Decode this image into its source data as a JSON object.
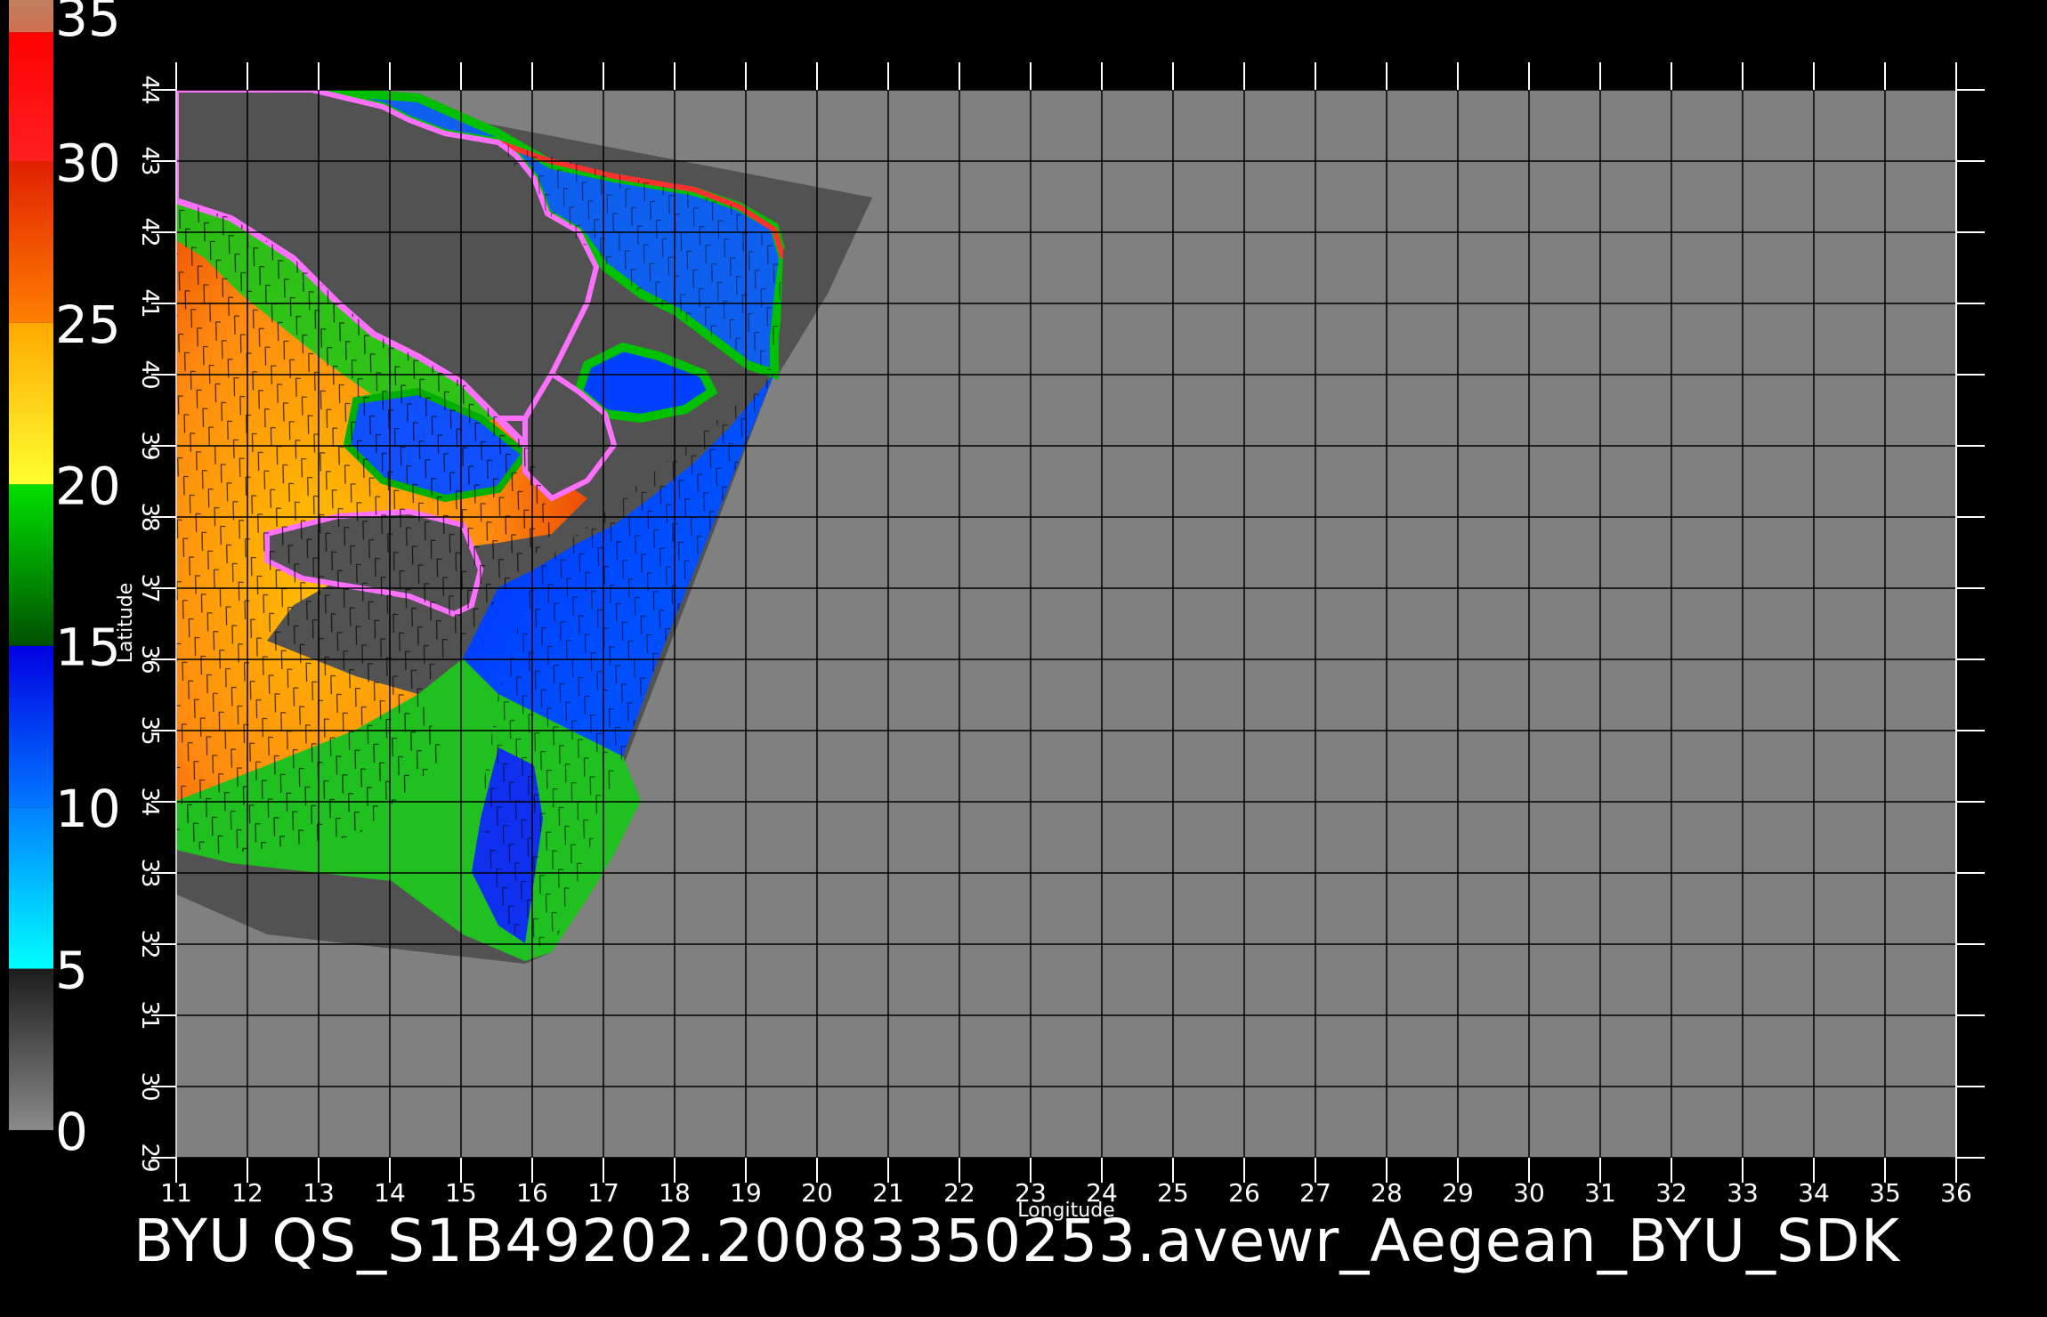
{
  "title": "BYU  QS_S1B49202.20083350253.avewr_Aegean_BYU_SDK",
  "axes": {
    "xlabel": "Longitude",
    "ylabel": "Latitude",
    "xlim": [
      11,
      36
    ],
    "ylim": [
      29,
      44
    ],
    "xticks": [
      "11",
      "12",
      "13",
      "14",
      "15",
      "16",
      "17",
      "18",
      "19",
      "20",
      "21",
      "22",
      "23",
      "24",
      "25",
      "26",
      "27",
      "28",
      "29",
      "30",
      "31",
      "32",
      "33",
      "34",
      "35",
      "36"
    ],
    "yticks": [
      "29",
      "30",
      "31",
      "32",
      "33",
      "34",
      "35",
      "36",
      "37",
      "38",
      "39",
      "40",
      "41",
      "42",
      "43",
      "44"
    ]
  },
  "colorbar": {
    "labels": [
      "0",
      "5",
      "10",
      "15",
      "20",
      "25",
      "30",
      "35"
    ],
    "range": [
      0,
      35
    ],
    "bands": [
      {
        "from": 0,
        "to": 5,
        "colors": [
          "#8a8a8a",
          "#1c1c1c"
        ]
      },
      {
        "from": 5,
        "to": 10,
        "colors": [
          "#00ffff",
          "#0080ff"
        ]
      },
      {
        "from": 10,
        "to": 15,
        "colors": [
          "#0078ff",
          "#0000e0"
        ]
      },
      {
        "from": 15,
        "to": 20,
        "colors": [
          "#005000",
          "#00e000"
        ]
      },
      {
        "from": 20,
        "to": 25,
        "colors": [
          "#ffff30",
          "#ffa800"
        ]
      },
      {
        "from": 25,
        "to": 30,
        "colors": [
          "#ff8000",
          "#e02000"
        ]
      },
      {
        "from": 30,
        "to": 34,
        "colors": [
          "#ff2020",
          "#ff0000"
        ]
      },
      {
        "from": 34,
        "to": 35,
        "colors": [
          "#d07050",
          "#c08060"
        ]
      }
    ]
  },
  "colors": {
    "background": "#000000",
    "no_data": "#808080",
    "land": "#505050",
    "grid": "#000000",
    "wind_barbs": "#000000",
    "coast_rim": "#ff70ff"
  }
}
